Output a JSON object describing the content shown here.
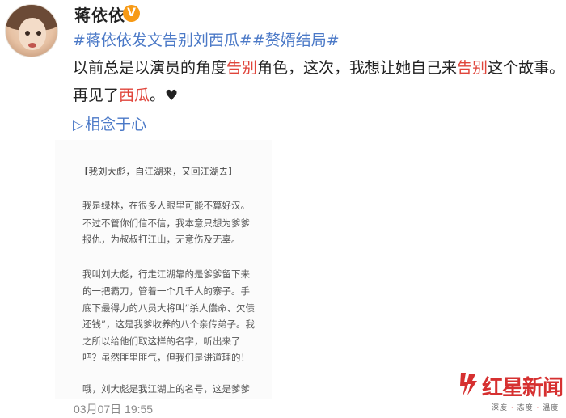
{
  "user": {
    "name": "蒋依依",
    "verified_badge": "V"
  },
  "post": {
    "hashtag1": "#蒋依依发文告别刘西瓜#",
    "hashtag2": "#赘婿结局#",
    "line2_a": "以前总是以演员的角度",
    "line2_b": "告别",
    "line2_c": "角色，这次，我想让她自己来",
    "line2_d": "告别",
    "line2_e": "这个故事。",
    "line3_a": "再见了",
    "line3_b": "西瓜",
    "line3_c": "。",
    "heart": "♥",
    "link_icon": "▷",
    "link_label": "相念于心"
  },
  "document": {
    "heading": "【我刘大彪，自江湖来，又回江湖去】",
    "paragraphs": [
      "我是绿林，在很多人眼里可能不算好汉。",
      "不过不管你们信不信，我本意只想为爹爹",
      "报仇，为叔叔打江山，无意伤及无辜。",
      "我叫刘大彪，行走江湖靠的是爹爹留下来",
      "的一把霸刀，管着一个几千人的寨子。手",
      "底下最得力的八员大将叫“杀人偿命、欠债",
      "还钱”，这是我爹收养的八个亲传弟子。我",
      "之所以给他们取这样的名字，听出来了",
      "吧？虽然匪里匪气，但我们是讲道理的！",
      "哦，刘大彪是我江湖上的名号，这是爹爹"
    ]
  },
  "timestamp": "03月07日 19:55",
  "watermark": {
    "title": "红星新闻",
    "subtitle_a": "深度",
    "subtitle_b": "态度",
    "subtitle_c": "温度"
  },
  "colors": {
    "hashtag": "#4b79c7",
    "highlight": "#e0453b",
    "verified": "#f79a16",
    "watermark": "#d63030"
  }
}
